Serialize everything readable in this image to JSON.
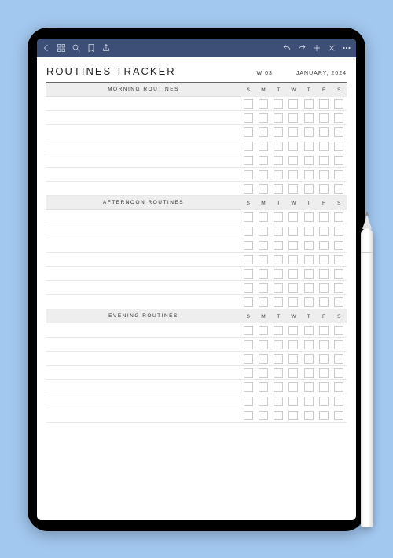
{
  "header": {
    "title": "ROUTINES TRACKER",
    "week": "W 03",
    "date": "JANUARY, 2024"
  },
  "days": [
    "S",
    "M",
    "T",
    "W",
    "T",
    "F",
    "S"
  ],
  "sections": [
    {
      "title": "MORNING ROUTINES",
      "rows": 7
    },
    {
      "title": "AFTERNOON ROUTINES",
      "rows": 7
    },
    {
      "title": "EVENING ROUTINES",
      "rows": 7
    }
  ]
}
